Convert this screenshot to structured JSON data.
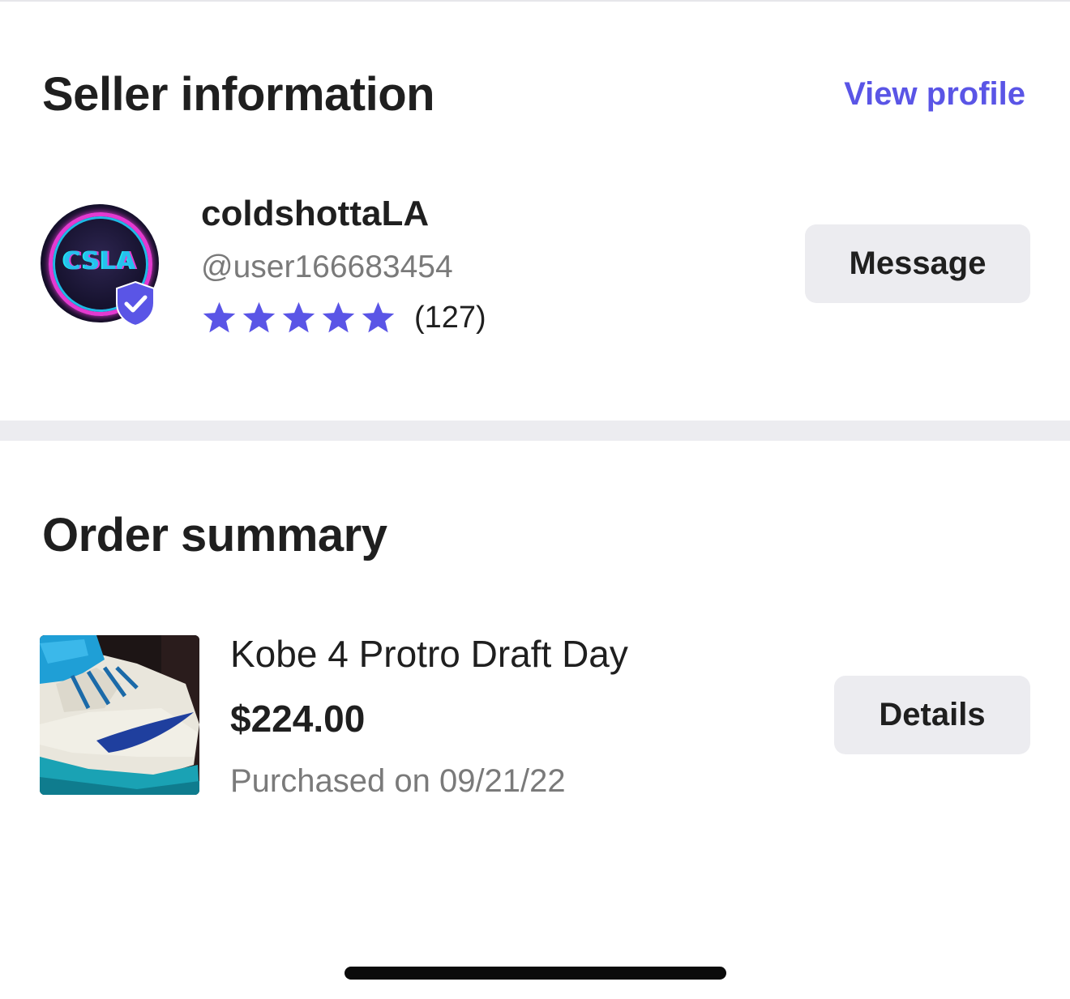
{
  "seller_section": {
    "title": "Seller information",
    "view_profile_label": "View profile",
    "seller": {
      "name": "coldshottaLA",
      "handle": "@user166683454",
      "rating_stars": 5,
      "rating_count": "(127)",
      "avatar_text": "CSLA",
      "verified": true
    },
    "message_label": "Message"
  },
  "order_section": {
    "title": "Order summary",
    "item": {
      "name": "Kobe 4 Protro Draft Day",
      "price": "$224.00",
      "purchase_date": "Purchased on 09/21/22"
    },
    "details_label": "Details"
  },
  "colors": {
    "accent": "#5a55e6",
    "star": "#5a55e6",
    "button_bg": "#ececf0",
    "divider": "#ececf0",
    "text_primary": "#1f1f1f",
    "text_secondary": "#7a7a7a"
  },
  "icons": {
    "star": "star-icon",
    "verified": "verified-shield-icon"
  }
}
